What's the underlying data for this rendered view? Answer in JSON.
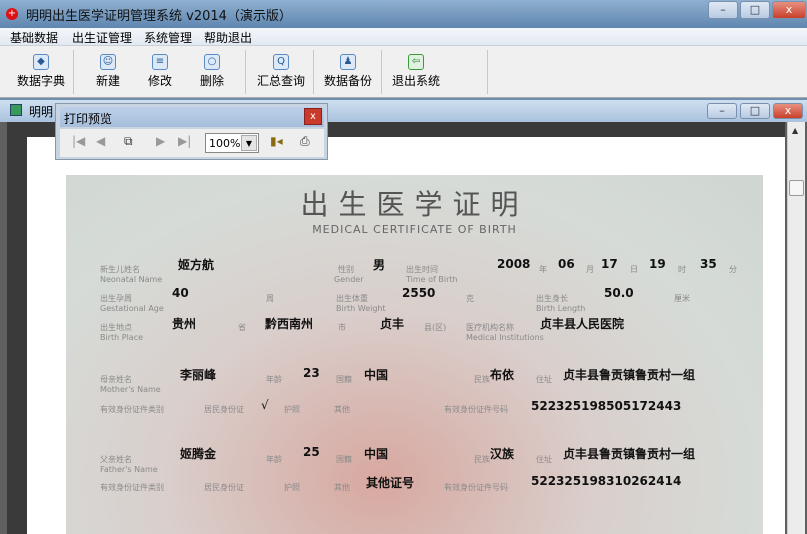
{
  "window": {
    "title": "明明出生医学证明管理系统 v2014（演示版）",
    "app_icon": "red-cross-icon"
  },
  "menu": [
    "基础数据",
    "出生证管理",
    "系统管理",
    "帮助退出"
  ],
  "toolbar": [
    {
      "label": "数据字典",
      "icon": "book-icon"
    },
    {
      "label": "新建",
      "icon": "new-person-icon"
    },
    {
      "label": "修改",
      "icon": "edit-list-icon"
    },
    {
      "label": "删除",
      "icon": "delete-icon"
    },
    {
      "label": "汇总查询",
      "icon": "search-icon"
    },
    {
      "label": "数据备份",
      "icon": "backup-icon"
    },
    {
      "label": "退出系统",
      "icon": "exit-door-icon"
    }
  ],
  "child": {
    "title": "明明"
  },
  "print_preview": {
    "title": "打印预览",
    "zoom": "100%",
    "close": "x"
  },
  "certificate": {
    "title": "出生医学证明",
    "subtitle": "MEDICAL CERTIFICATE OF BIRTH",
    "labels": {
      "name": "新生儿姓名",
      "name_en": "Neonatal Name",
      "gender": "性别",
      "gender_en": "Gender",
      "time": "出生时间",
      "time_en": "Time of Birth",
      "year": "年",
      "month": "月",
      "day": "日",
      "hour": "时",
      "minute": "分",
      "gest": "出生孕周",
      "gest_en": "Gestational Age",
      "week": "周",
      "weight": "出生体重",
      "weight_en": "Birth Weight",
      "g": "克",
      "length": "出生身长",
      "length_en": "Birth Length",
      "cm": "厘米",
      "place": "出生地点",
      "place_en": "Birth Place",
      "province": "省",
      "city": "市",
      "county": "县(区)",
      "inst": "医疗机构名称",
      "inst_en": "Medical Institutions",
      "mother": "母亲姓名",
      "mother_en": "Mother's Name",
      "father": "父亲姓名",
      "father_en": "Father's Name",
      "age": "年龄",
      "nationality": "国籍",
      "ethnic": "民族",
      "address": "住址",
      "idtype": "有效身份证件类别",
      "idcard": "居民身份证",
      "passport": "护照",
      "others": "其他",
      "idno": "有效身份证件号码"
    },
    "baby": {
      "name": "姬方航",
      "gender": "男",
      "year": "2008",
      "month": "06",
      "day": "17",
      "hour": "19",
      "minute": "35",
      "gest_weeks": "40",
      "weight": "2550",
      "length": "50.0",
      "province": "贵州",
      "city": "黔西南州",
      "county": "贞丰",
      "institution": "贞丰县人民医院"
    },
    "mother": {
      "name": "李丽峰",
      "age": "23",
      "nationality": "中国",
      "ethnic": "布依",
      "address": "贞丰县鲁贡镇鲁贡村一组",
      "id_check": "√",
      "id_no": "522325198505172443"
    },
    "father": {
      "name": "姬腾金",
      "age": "25",
      "nationality": "中国",
      "ethnic": "汉族",
      "address": "贞丰县鲁贡镇鲁贡村一组",
      "other_id": "其他证号",
      "id_no": "522325198310262414"
    }
  }
}
